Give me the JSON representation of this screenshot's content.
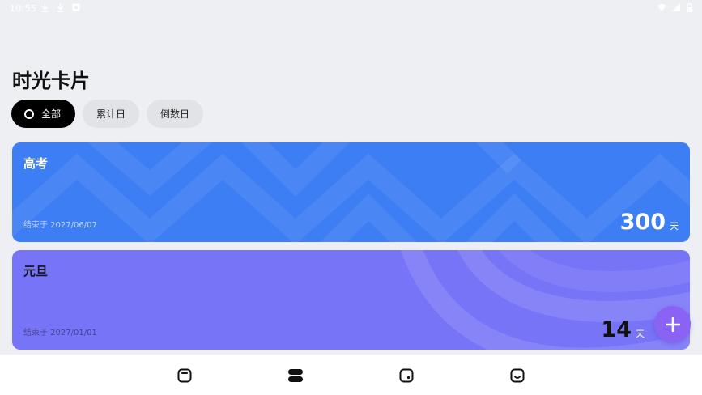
{
  "status_bar": {
    "time": "10:55",
    "left_icons": [
      "download-icon",
      "download-icon",
      "square-notification-icon"
    ],
    "right_icons": [
      "wifi-icon",
      "signal-icon",
      "battery-icon"
    ]
  },
  "page": {
    "title": "时光卡片"
  },
  "filters": [
    {
      "label": "全部",
      "active": true
    },
    {
      "label": "累计日",
      "active": false
    },
    {
      "label": "倒数日",
      "active": false
    }
  ],
  "cards": [
    {
      "title": "高考",
      "date": "结束于 2027/06/07",
      "count": "300",
      "unit": "天",
      "color": "#3d7ef5"
    },
    {
      "title": "元旦",
      "date": "结束于 2027/01/01",
      "count": "14",
      "unit": "天",
      "color": "#7774f8"
    }
  ],
  "fab": {
    "icon": "plus-icon",
    "color": "#8a63f5"
  },
  "bottom_nav": [
    {
      "icon": "card-icon",
      "active": false
    },
    {
      "icon": "list-icon",
      "active": true
    },
    {
      "icon": "square-dot-icon",
      "active": false
    },
    {
      "icon": "smile-icon",
      "active": false
    }
  ]
}
